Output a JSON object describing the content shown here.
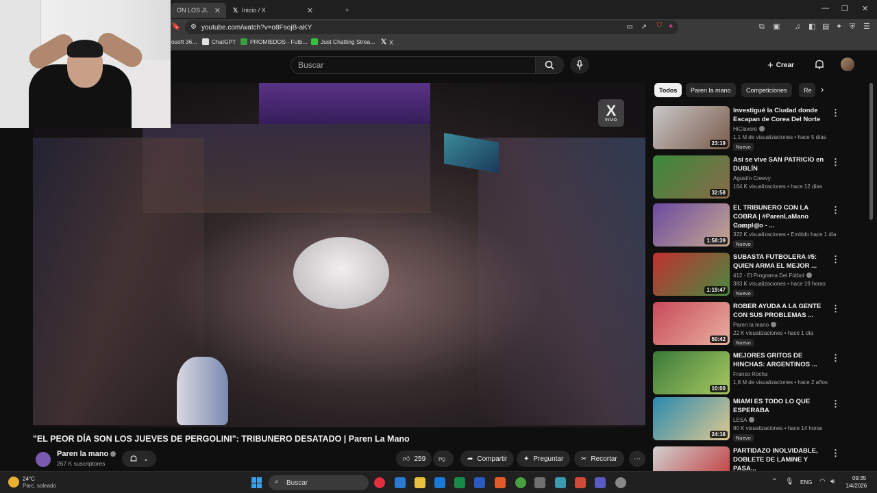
{
  "browser": {
    "tabs": [
      {
        "label": "ON LOS JUEVES D",
        "active": true
      },
      {
        "label": "Inicio / X",
        "active": false
      }
    ],
    "new_tab": "+",
    "url": "youtube.com/watch?v=o8FsojB-aKY",
    "bookmarks": [
      {
        "label": "osoft 36...",
        "color": "#d04020"
      },
      {
        "label": "ChatGPT",
        "color": "#e0e0e0"
      },
      {
        "label": "PROMIEDOS - Futb...",
        "color": "#3aa040"
      },
      {
        "label": "Just Chatting Strea...",
        "color": "#35c040"
      },
      {
        "label": "X",
        "color": "#101010"
      }
    ]
  },
  "yt": {
    "search_placeholder": "Buscar",
    "create_label": "Crear",
    "create_icon": "plus-icon",
    "logo_big": "X",
    "logo_small": "VIVO"
  },
  "video": {
    "title": "\"EL PEOR DÍA SON LOS JUEVES DE PERGOLINI\": TRIBUNERO DESATADO | Paren La Mano",
    "channel": "Paren la mano",
    "subscribers": "267 K suscriptores",
    "likes": "259",
    "share": "Compartir",
    "ask": "Preguntar",
    "clip": "Recortar",
    "more": "⋯"
  },
  "sidebar": {
    "chips": [
      "Todos",
      "Paren la mano",
      "Competiciones",
      "Re"
    ],
    "recommendations": [
      {
        "title": "Investigué la Ciudad donde Escapan de Corea Del Norte",
        "channel": "HiClavero",
        "verified": true,
        "meta": "1,1 M de visualizaciones • hace 5 días",
        "duration": "23:19",
        "badge": "Nuevo",
        "thumb": [
          "#c8c8c8",
          "#7a5a4a"
        ]
      },
      {
        "title": "Así se vive SAN PATRICIO en DUBLÍN",
        "channel": "Agustín Creevy",
        "verified": false,
        "meta": "164 K visualizaciones • hace 12 días",
        "duration": "32:58",
        "badge": "",
        "thumb": [
          "#3a8a3a",
          "#8a6a4a"
        ]
      },
      {
        "title": "EL TRIBUNERO CON LA COBRA | #ParenLaMano Completo - ...",
        "channel": "Vorterix",
        "verified": true,
        "meta": "322 K visualizaciones • Emitido hace 1 día",
        "duration": "1:58:39",
        "badge": "Nuevo",
        "thumb": [
          "#6a4aa0",
          "#c8a890"
        ]
      },
      {
        "title": "SUBASTA FUTBOLERA #5: QUIEN ARMA EL MEJOR ...",
        "channel": "412 - El Programa Del Fútbol",
        "verified": true,
        "meta": "383 K visualizaciones • hace 19 horas",
        "duration": "1:19:47",
        "badge": "Nuevo",
        "thumb": [
          "#c03030",
          "#4a8a40"
        ]
      },
      {
        "title": "ROBER AYUDA A LA GENTE CON SUS PROBLEMAS ...",
        "channel": "Paren la mano",
        "verified": true,
        "meta": "22 K visualizaciones • hace 1 día",
        "duration": "50:42",
        "badge": "Nuevo",
        "thumb": [
          "#c84a5a",
          "#e8b0a0"
        ]
      },
      {
        "title": "MEJORES GRITOS DE HINCHAS: ARGENTINOS ...",
        "channel": "Franco Rocha",
        "verified": false,
        "meta": "1,8 M de visualizaciones • hace 2 años",
        "duration": "10:00",
        "badge": "",
        "thumb": [
          "#3a7a3a",
          "#a8c860"
        ]
      },
      {
        "title": "MIAMI ES TODO LO QUE ESPERABA",
        "channel": "LESA",
        "verified": true,
        "meta": "90 K visualizaciones • hace 14 horas",
        "duration": "24:16",
        "badge": "Nuevo",
        "thumb": [
          "#2a8ab0",
          "#e0c890"
        ]
      },
      {
        "title": "PARTIDAZO INOLVIDABLE, DOBLETE DE LAMINE Y PASA...",
        "channel": "",
        "verified": false,
        "meta": "",
        "duration": "",
        "badge": "",
        "thumb": [
          "#d0d0d0",
          "#c03030"
        ]
      }
    ]
  },
  "taskbar": {
    "temp": "24°C",
    "weather": "Parc. soleado",
    "search": "Buscar",
    "lang": "ENG",
    "time": "09:35",
    "date": "1/4/2026"
  }
}
